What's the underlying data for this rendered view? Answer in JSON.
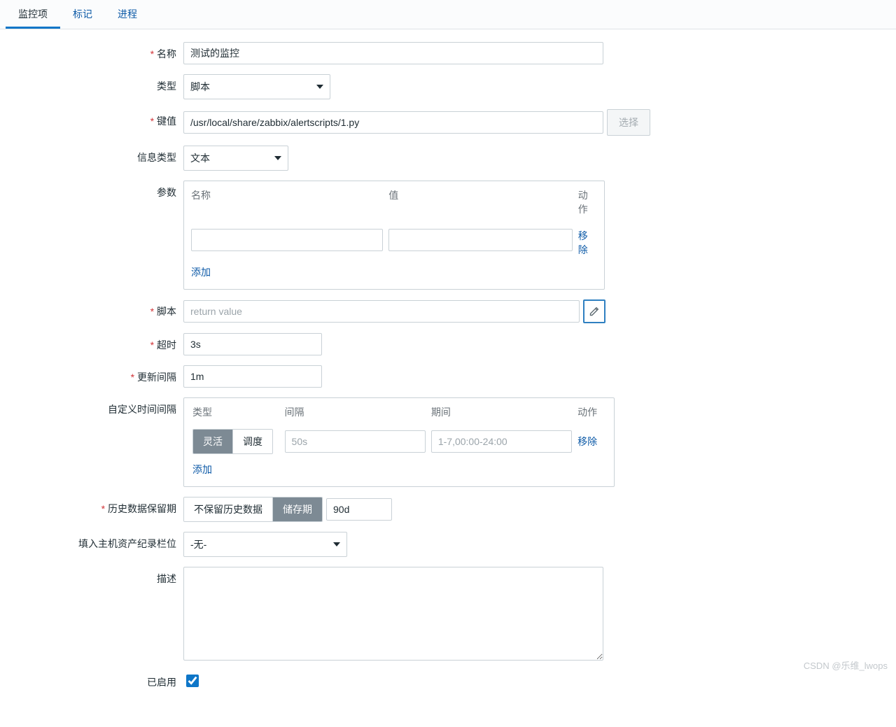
{
  "tabs": {
    "item": "监控项",
    "tags": "标记",
    "process": "进程"
  },
  "labels": {
    "name": "名称",
    "type": "类型",
    "key": "键值",
    "infoType": "信息类型",
    "params": "参数",
    "script": "脚本",
    "timeout": "超时",
    "interval": "更新间隔",
    "custom": "自定义时间间隔",
    "history": "历史数据保留期",
    "inventory": "填入主机资产纪录栏位",
    "description": "描述",
    "enabled": "已启用"
  },
  "values": {
    "name": "测试的监控",
    "type": "脚本",
    "key": "/usr/local/share/zabbix/alertscripts/1.py",
    "infoType": "文本",
    "timeout": "3s",
    "interval": "1m",
    "historyDays": "90d",
    "inventory": "-无-"
  },
  "buttons": {
    "select": "选择",
    "add": "添加",
    "remove": "移除",
    "removeMultiline": "移\n除"
  },
  "placeholders": {
    "script": "return value",
    "intervalVal": "50s",
    "period": "1-7,00:00-24:00"
  },
  "paramsHeaders": {
    "name": "名称",
    "value": "值",
    "action": "动作"
  },
  "intervalHeaders": {
    "type": "类型",
    "interval": "间隔",
    "period": "期间",
    "action": "动作"
  },
  "segments": {
    "flexible": "灵活",
    "scheduling": "调度",
    "noHistory": "不保留历史数据",
    "storage": "储存期"
  },
  "watermark": "CSDN @乐维_lwops"
}
